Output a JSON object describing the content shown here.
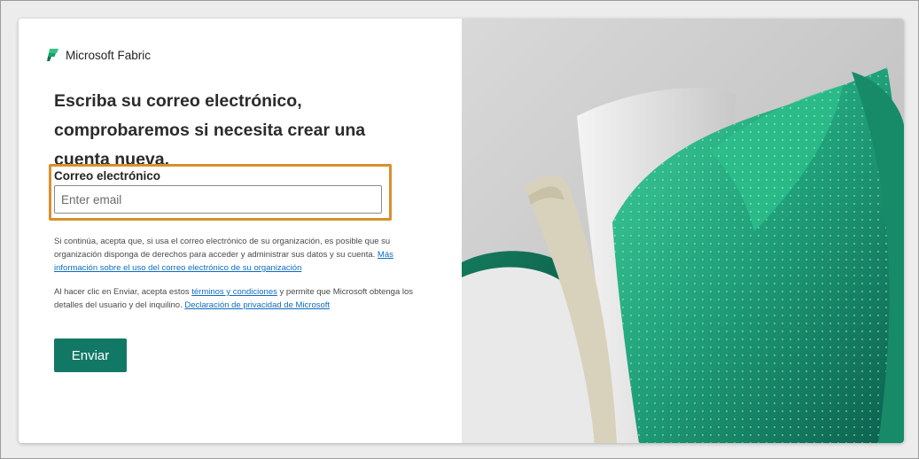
{
  "brand": {
    "name": "Microsoft Fabric",
    "logo_icon": "fabric-logo-icon"
  },
  "heading": "Escriba su correo electrónico, comprobaremos si necesita crear una cuenta nueva.",
  "email": {
    "label": "Correo electrónico",
    "placeholder": "Enter email",
    "value": ""
  },
  "notice": {
    "text": "Si continúa, acepta que, si usa el correo electrónico de su organización, es posible que su organización disponga de derechos para acceder y administrar sus datos y su cuenta. ",
    "link": "Más información sobre el uso del correo electrónico de su organización"
  },
  "terms": {
    "prefix": "Al hacer clic en Enviar, acepta estos ",
    "terms_link": "términos y condiciones",
    "middle": " y permite que Microsoft obtenga los detalles del usuario y del inquilino. ",
    "privacy_link": "Declaración de privacidad de Microsoft"
  },
  "submit_label": "Enviar",
  "colors": {
    "accent": "#117865",
    "highlight": "#d9902b",
    "link": "#0f6cbd"
  },
  "hero_image": "fabric-green-petals-illustration"
}
